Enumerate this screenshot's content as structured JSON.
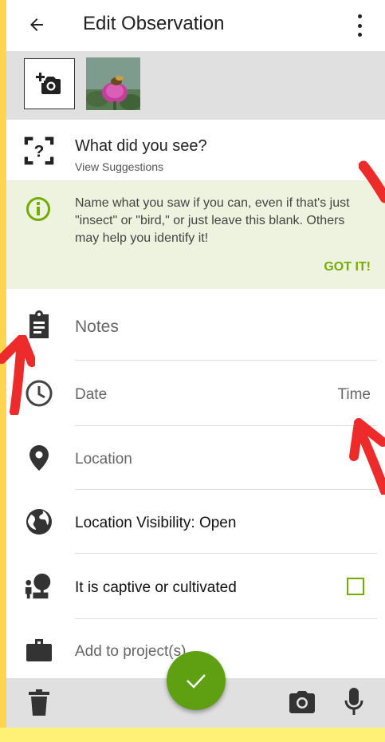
{
  "appbar": {
    "title": "Edit Observation"
  },
  "identify": {
    "prompt": "What did you see?",
    "suggestions_link": "View Suggestions"
  },
  "tip": {
    "text": "Name what you saw if you can, even if that's just \"insect\" or \"bird,\" or just leave this blank. Others may help you identify it!",
    "dismiss": "GOT IT!"
  },
  "fields": {
    "notes": "Notes",
    "date": "Date",
    "time": "Time",
    "location": "Location",
    "visibility": "Location Visibility: Open",
    "captive": "It is captive or cultivated",
    "captive_checked": false,
    "projects": "Add to project(s)"
  },
  "colors": {
    "accent": "#74ac00",
    "fab": "#5f9f12",
    "annotation_arrow": "#ee2b2b",
    "frame": "#ffd54f"
  },
  "icons": [
    "back-arrow-icon",
    "more-vert-icon",
    "add-photo-icon",
    "identify-icon",
    "info-icon",
    "clipboard-icon",
    "clock-icon",
    "location-pin-icon",
    "globe-icon",
    "captive-icon",
    "briefcase-icon",
    "trash-icon",
    "camera-icon",
    "microphone-icon",
    "check-icon"
  ]
}
